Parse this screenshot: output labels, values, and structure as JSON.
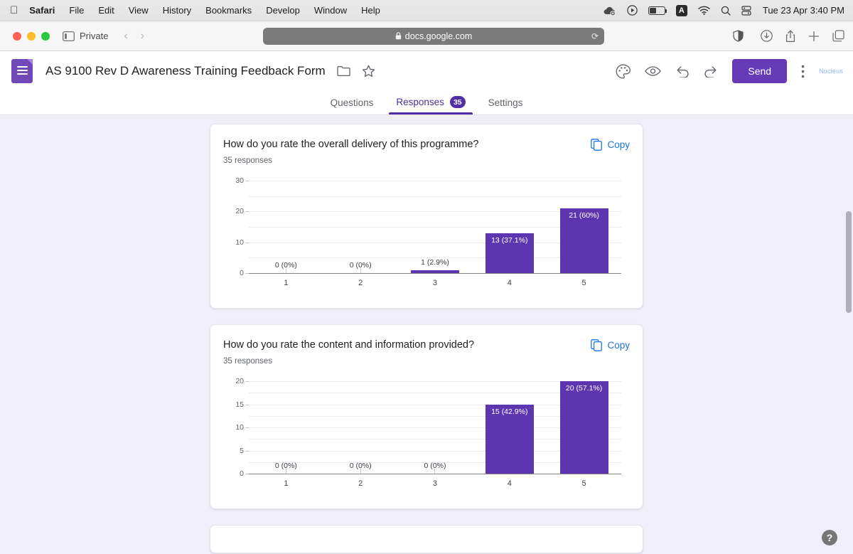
{
  "menubar": {
    "apple_glyph": "apple-logo",
    "items": [
      "Safari",
      "File",
      "Edit",
      "View",
      "History",
      "Bookmarks",
      "Develop",
      "Window",
      "Help"
    ],
    "status_icons": [
      "cloud-offline-icon",
      "play-circle-icon",
      "battery-charging-icon",
      "keyboard-input-A-icon",
      "wifi-icon",
      "search-icon",
      "control-center-icon"
    ],
    "clock": "Tue 23 Apr  3:40 PM"
  },
  "safari": {
    "private_label": "Private",
    "back_glyph": "‹",
    "forward_glyph": "›",
    "url": "docs.google.com",
    "lock_glyph": "🔒",
    "reload_glyph": "⟳",
    "right_icons": [
      "downloads-icon",
      "share-icon",
      "new-tab-icon",
      "tab-overview-icon"
    ]
  },
  "form": {
    "title": "AS 9100 Rev D Awareness Training Feedback Form",
    "move_folder_icon": "folder-icon",
    "star_icon": "star-icon",
    "theme_icon": "palette-icon",
    "preview_icon": "eye-icon",
    "undo_icon": "undo-icon",
    "redo_icon": "redo-icon",
    "send_label": "Send",
    "more_icon": "more-vertical-icon",
    "account_label": "Nucleus",
    "accent_color": "#673ab7",
    "bar_color": "#5e35b1",
    "link_color": "#1a73e8"
  },
  "tabs": [
    {
      "label": "Questions",
      "active": false,
      "badge": ""
    },
    {
      "label": "Responses",
      "active": true,
      "badge": "35"
    },
    {
      "label": "Settings",
      "active": false,
      "badge": ""
    }
  ],
  "copy_label": "Copy",
  "help_glyph": "?",
  "chart_data": [
    {
      "type": "bar",
      "title": "How do you rate the overall delivery of this programme?",
      "subtitle": "35 responses",
      "categories": [
        "1",
        "2",
        "3",
        "4",
        "5"
      ],
      "values": [
        0,
        0,
        1,
        13,
        21
      ],
      "labels": [
        "0 (0%)",
        "0 (0%)",
        "1 (2.9%)",
        "13 (37.1%)",
        "21 (60%)"
      ],
      "xlabel": "",
      "ylabel": "",
      "ylim": [
        0,
        30
      ],
      "yticks": [
        0,
        10,
        20,
        30
      ],
      "grid": true,
      "legend": "none"
    },
    {
      "type": "bar",
      "title": "How do you rate the content and information provided?",
      "subtitle": "35 responses",
      "categories": [
        "1",
        "2",
        "3",
        "4",
        "5"
      ],
      "values": [
        0,
        0,
        0,
        15,
        20
      ],
      "labels": [
        "0 (0%)",
        "0 (0%)",
        "0 (0%)",
        "15 (42.9%)",
        "20 (57.1%)"
      ],
      "xlabel": "",
      "ylabel": "",
      "ylim": [
        0,
        20
      ],
      "yticks": [
        0,
        5,
        10,
        15,
        20
      ],
      "grid": true,
      "legend": "none"
    }
  ]
}
